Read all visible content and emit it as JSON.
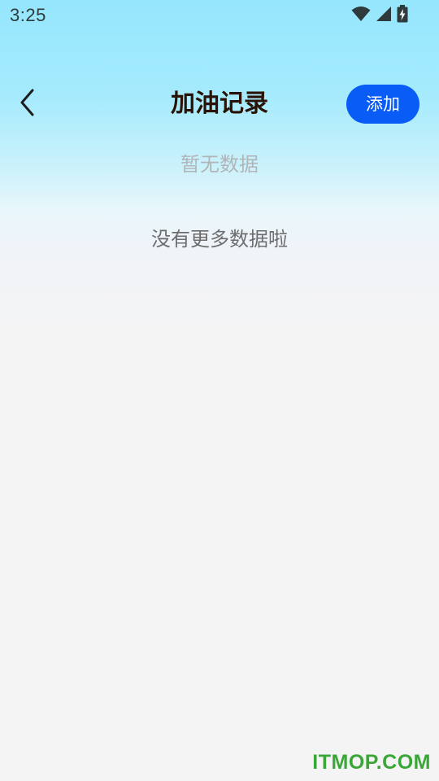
{
  "status_bar": {
    "time": "3:25",
    "icons": [
      "wifi-icon",
      "cellular-signal-icon",
      "battery-charging-icon"
    ]
  },
  "header": {
    "title": "加油记录",
    "back_icon": "chevron-left-icon",
    "add_label": "添加"
  },
  "content": {
    "empty_text": "暂无数据",
    "no_more_text": "没有更多数据啦"
  },
  "watermark": {
    "text": "ITMOP.COM"
  },
  "colors": {
    "accent": "#0a5cf7",
    "title": "#2b1207",
    "watermark": "#3aa638"
  }
}
